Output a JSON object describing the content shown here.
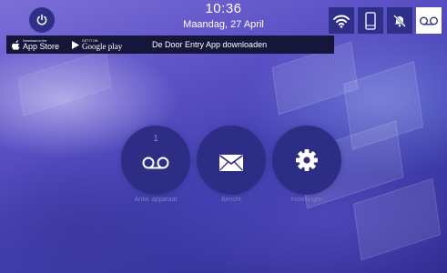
{
  "header": {
    "time": "10:36",
    "date": "Maandag, 27 April"
  },
  "status_icons": [
    {
      "name": "wifi-icon",
      "active": false
    },
    {
      "name": "phone-icon",
      "active": false
    },
    {
      "name": "bell-muted-icon",
      "active": false
    },
    {
      "name": "voicemail-icon",
      "active": true
    }
  ],
  "banner": {
    "app_store_small": "Download on the",
    "app_store_label": "App Store",
    "google_play_small": "GET IT ON",
    "google_play_label": "Google play",
    "message": "De Door Entry App downloaden"
  },
  "menu": {
    "answering_machine": {
      "count": "1",
      "label": "Antw. apparaat"
    },
    "message": {
      "label": "Bericht"
    },
    "settings": {
      "label": "Instellingen"
    }
  },
  "colors": {
    "button": "#2d2d86",
    "status_active": "#ffffff",
    "banner": "#16163a"
  }
}
